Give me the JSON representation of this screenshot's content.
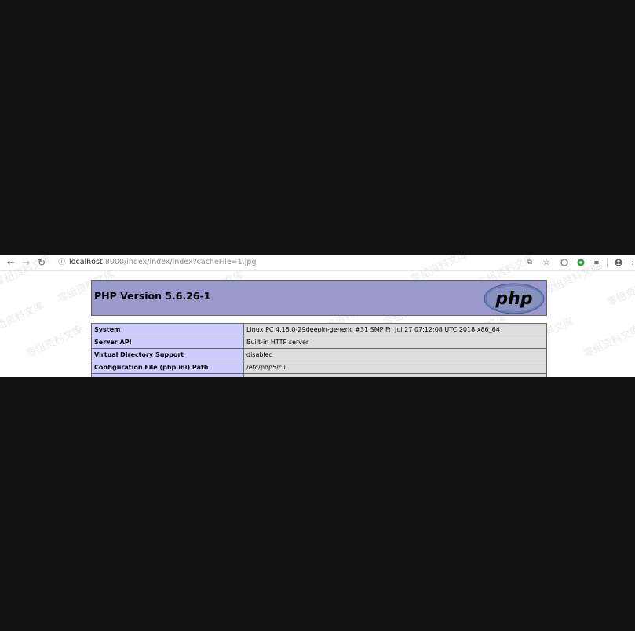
{
  "browser": {
    "url_host": "localhost",
    "url_path": ":8000/index/index/index?cacheFile=1.jpg"
  },
  "php": {
    "title": "PHP Version 5.6.26-1",
    "logo_text": "php",
    "rows": [
      {
        "label": "System",
        "value": "Linux PC 4.15.0-29deepin-generic #31 SMP Fri Jul 27 07:12:08 UTC 2018 x86_64"
      },
      {
        "label": "Server API",
        "value": "Built-in HTTP server"
      },
      {
        "label": "Virtual Directory Support",
        "value": "disabled"
      },
      {
        "label": "Configuration File (php.ini) Path",
        "value": "/etc/php5/cli"
      },
      {
        "label": "",
        "value": ""
      }
    ]
  },
  "watermark_text": "零组资料文库",
  "colors": {
    "header_bg": "#9999cc",
    "label_bg": "#ccccff",
    "value_bg": "#dddddd",
    "backdrop": "#111111"
  },
  "icons": {
    "back": "arrow-left-icon",
    "forward": "arrow-right-icon",
    "reload": "reload-icon",
    "info": "info-icon",
    "translate": "translate-icon",
    "bookmark": "star-icon",
    "profile": "account-icon",
    "menu": "menu-icon"
  }
}
